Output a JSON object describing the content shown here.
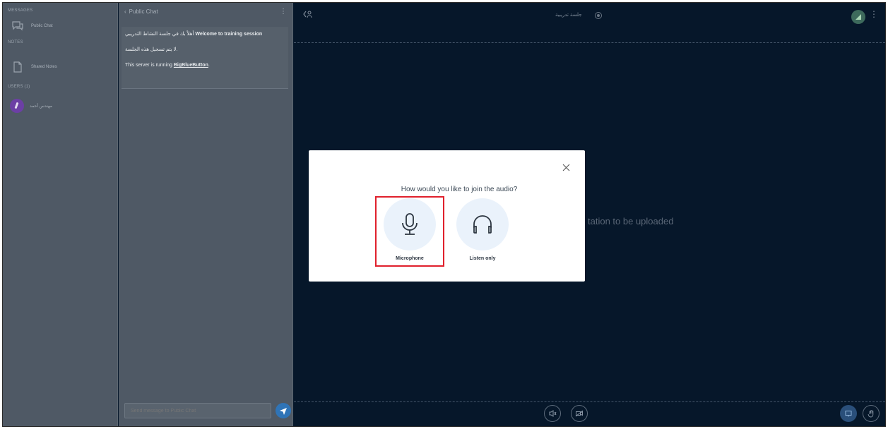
{
  "sidebar": {
    "headings": {
      "messages": "MESSAGES",
      "notes": "NOTES",
      "users": "USERS (1)"
    },
    "items": {
      "public_chat": "Public Chat",
      "shared_notes": "Shared Notes",
      "user_name": "مهندس أحمد"
    }
  },
  "chat": {
    "header_title": "Public Chat",
    "messages": {
      "welcome_ar": "أهلاً بك في جلسة النشاط التدريبي",
      "welcome_en": "Welcome to training session",
      "recording_ar": "لا يتم تسجيل هذه الجلسة.",
      "server_prefix": "This server is running ",
      "server_link": "BigBlueButton",
      "server_suffix": "."
    },
    "input_placeholder": "Send message to Public Chat"
  },
  "main": {
    "session_title": "جلسة تدريبية",
    "waiting_text": "tation to be uploaded"
  },
  "modal": {
    "title": "How would you like to join the audio?",
    "microphone_label": "Microphone",
    "listen_only_label": "Listen only"
  },
  "colors": {
    "highlight": "#e0202c",
    "send_button": "#2f74b7",
    "avatar": "#6c3fa5"
  }
}
